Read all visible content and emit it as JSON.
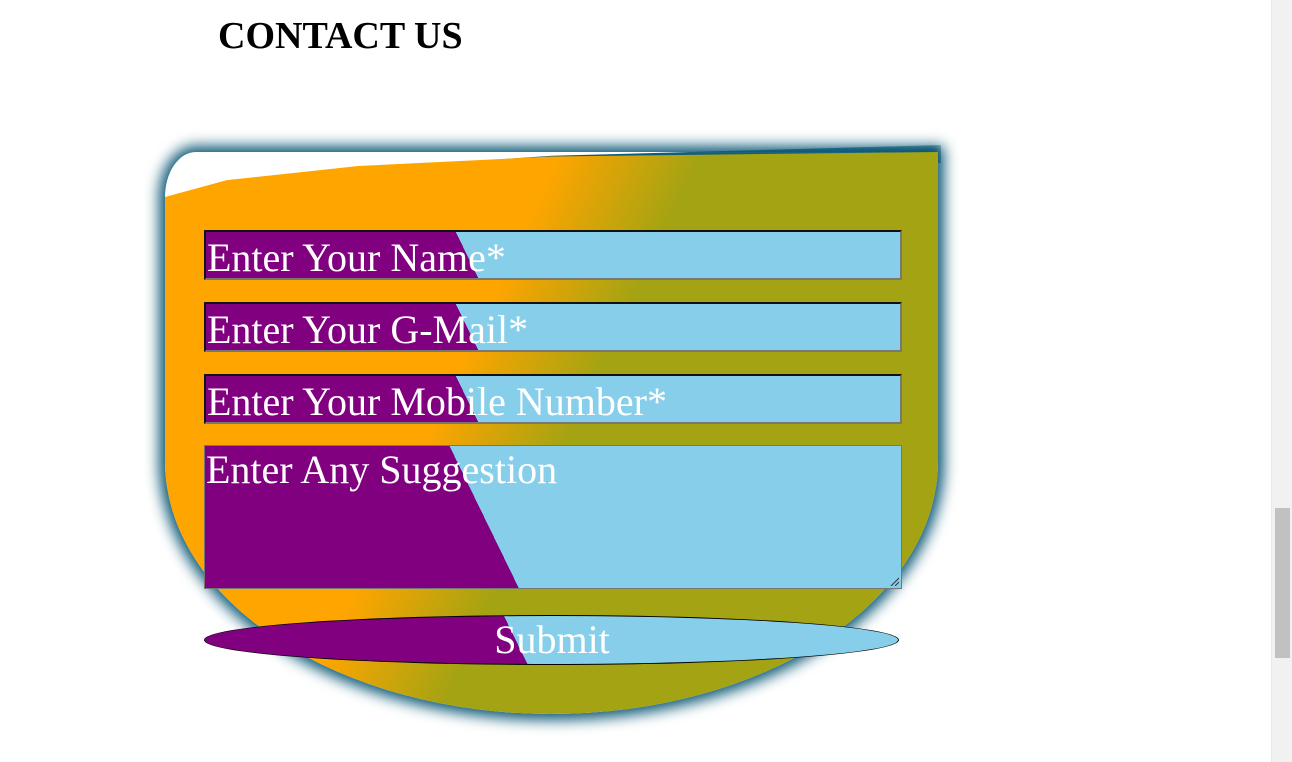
{
  "page": {
    "title": "CONTACT US"
  },
  "form": {
    "name_placeholder": "Enter Your Name*",
    "email_placeholder": "Enter Your G-Mail*",
    "mobile_placeholder": "Enter Your Mobile Number*",
    "suggestion_placeholder": "Enter Any Suggestion",
    "submit_label": "Submit"
  },
  "colors": {
    "card_left": "#ffa500",
    "card_right": "#a3a313",
    "card_glow": "#0b5876",
    "field_left": "#800080",
    "field_right": "#87ceeb",
    "text": "#ffffff"
  }
}
